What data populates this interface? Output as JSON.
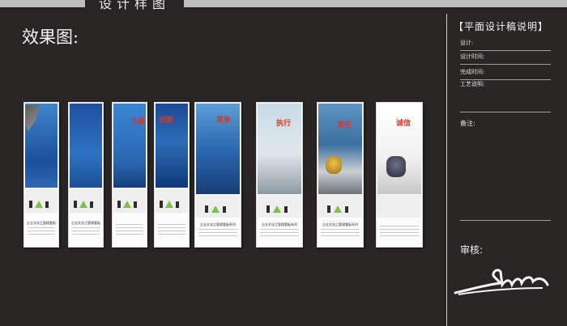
{
  "header": {
    "title": "设计样图"
  },
  "effect_label": "效果图:",
  "panel": {
    "title": "【平面设计稿说明】",
    "fields": [
      "设计:",
      "设计时间:",
      "完成时间:",
      "工艺说明:"
    ],
    "note_label": "备注:",
    "audit_label": "审核:"
  },
  "banners": [
    {
      "headline": "",
      "footer": "企业文化之管理看板"
    },
    {
      "headline": "",
      "footer": "企业文化之管理看板"
    },
    {
      "headline": "共赢",
      "footer": ""
    },
    {
      "headline": "创新",
      "footer": ""
    },
    {
      "headline": "竞争",
      "footer": "企业文化之管理看板系列"
    },
    {
      "headline": "执行",
      "footer": "企业文化之管理看板系列"
    },
    {
      "headline": "责任",
      "footer": "企业文化之管理看板系列"
    },
    {
      "headline": "诚信",
      "footer": ""
    }
  ],
  "colors": {
    "background": "#2a2525",
    "accent_red": "#d03a2a",
    "sky_blue": "#2f6fb7"
  }
}
